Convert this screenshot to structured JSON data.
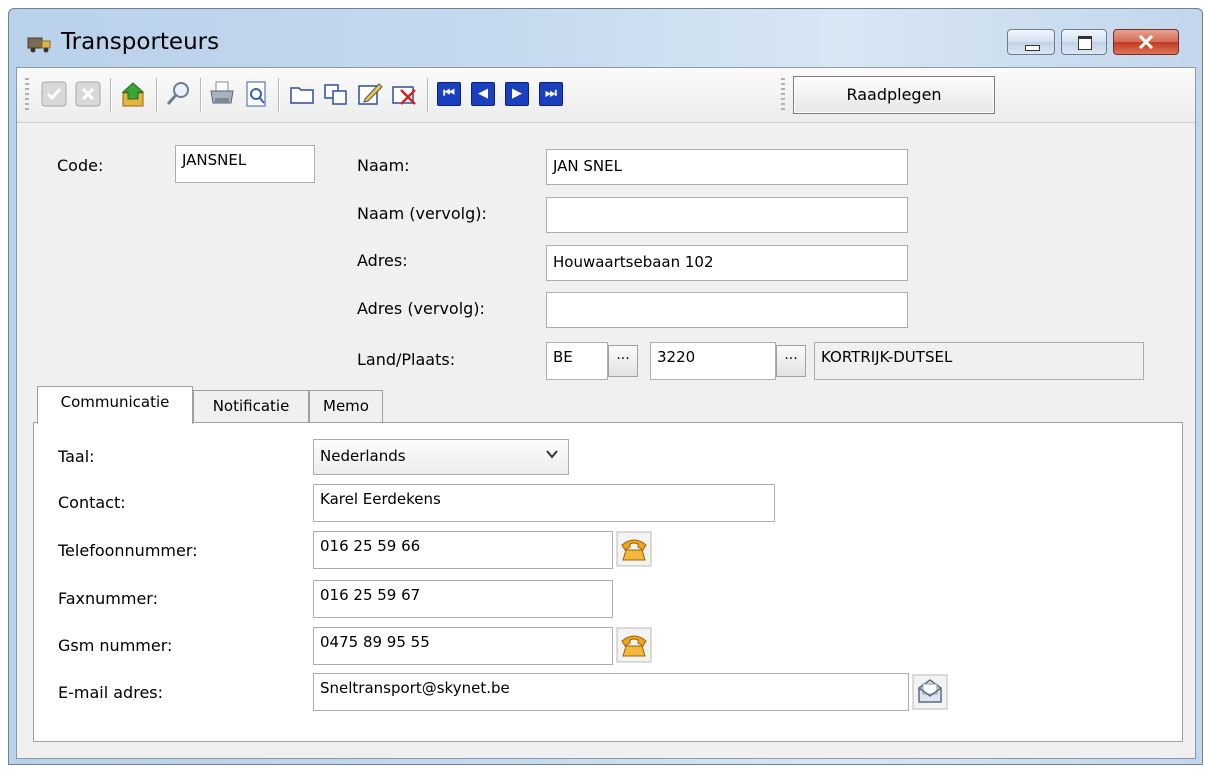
{
  "window": {
    "title": "Transporteurs",
    "title_icon": "truck-icon"
  },
  "toolbar": {
    "icons": [
      "check-icon",
      "cancel-icon",
      "export-icon",
      "search-icon",
      "print-icon",
      "print-preview-icon",
      "new-folder-icon",
      "copy-icon",
      "edit-icon",
      "delete-icon",
      "first-record-icon",
      "previous-record-icon",
      "next-record-icon",
      "last-record-icon"
    ],
    "mode_label": "Raadplegen"
  },
  "form": {
    "code_label": "Code:",
    "code_value": "JANSNEL",
    "naam_label": "Naam:",
    "naam_value": "JAN SNEL",
    "naam_vervolg_label": "Naam (vervolg):",
    "naam_vervolg_value": "",
    "adres_label": "Adres:",
    "adres_value": "Houwaartsebaan 102",
    "adres_vervolg_label": "Adres (vervolg):",
    "adres_vervolg_value": "",
    "land_plaats_label": "Land/Plaats:",
    "land_value": "BE",
    "postcode_value": "3220",
    "plaats_value": "KORTRIJK-DUTSEL",
    "ellipsis": "···"
  },
  "tabs": [
    {
      "label": "Communicatie",
      "active": true
    },
    {
      "label": "Notificatie",
      "active": false
    },
    {
      "label": "Memo",
      "active": false
    }
  ],
  "communicatie": {
    "taal_label": "Taal:",
    "taal_value": "Nederlands",
    "contact_label": "Contact:",
    "contact_value": "Karel Eerdekens",
    "telefoon_label": "Telefoonnummer:",
    "telefoon_value": "016 25 59 66",
    "fax_label": "Faxnummer:",
    "fax_value": "016 25 59 67",
    "gsm_label": "Gsm nummer:",
    "gsm_value": "0475 89 95 55",
    "email_label": "E-mail adres:",
    "email_value": "Sneltransport@skynet.be"
  },
  "colors": {
    "nav_blue": "#1a3fbf",
    "phone_icon": "#f0a41c",
    "close_button": "#c23a1f"
  }
}
